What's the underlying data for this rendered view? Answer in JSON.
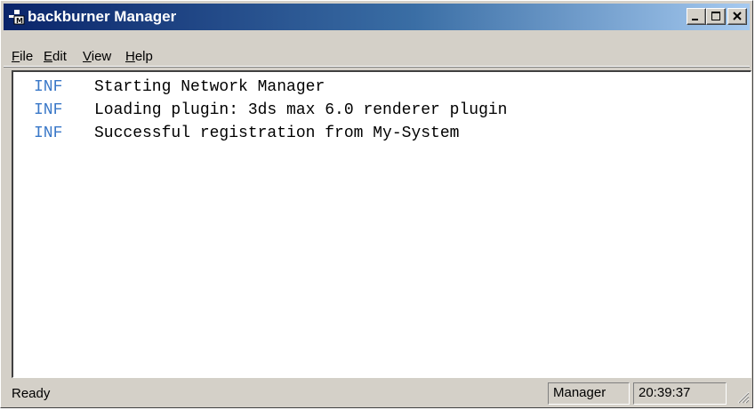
{
  "window": {
    "title": "backburner Manager",
    "icon": "backburner-manager-icon",
    "controls": {
      "minimize_icon": "minimize-icon",
      "maximize_icon": "maximize-icon",
      "close_icon": "close-icon"
    }
  },
  "menu": {
    "file": {
      "accel": "F",
      "rest": "ile"
    },
    "edit": {
      "accel": "E",
      "rest": "dit"
    },
    "view": {
      "accel": "V",
      "rest": "iew"
    },
    "help": {
      "accel": "H",
      "rest": "elp"
    }
  },
  "log": {
    "entries": [
      {
        "level": "INF",
        "message": "Starting Network Manager"
      },
      {
        "level": "INF",
        "message": "Loading plugin: 3ds max 6.0 renderer plugin"
      },
      {
        "level": "INF",
        "message": "Successful registration from My-System"
      }
    ],
    "level_color": "#3a78c8"
  },
  "status": {
    "text": "Ready",
    "mode": "Manager",
    "time": "20:39:37"
  },
  "colors": {
    "titlebar_start": "#0a246a",
    "titlebar_end": "#a6caf0",
    "chrome": "#d4d0c8"
  }
}
